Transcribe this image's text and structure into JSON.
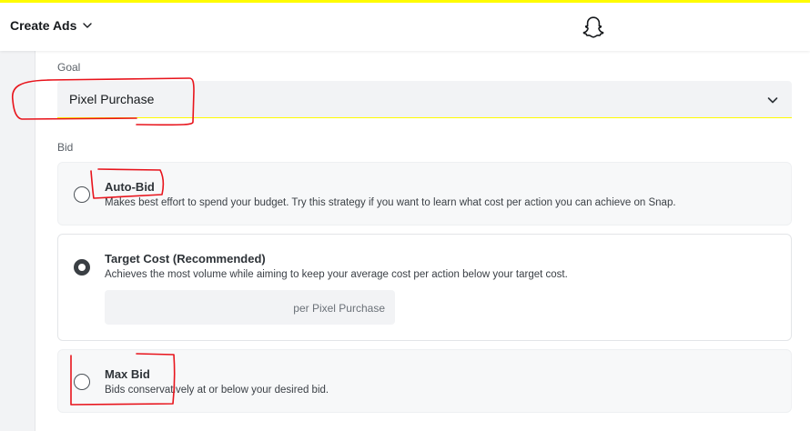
{
  "header": {
    "title": "Create Ads",
    "title_chevron_icon": "chevron-down-icon",
    "logo_icon": "snapchat-ghost-icon",
    "accent_color": "#fffc00"
  },
  "goal": {
    "label": "Goal",
    "selected_value": "Pixel Purchase",
    "chevron_icon": "chevron-down-icon"
  },
  "bid": {
    "label": "Bid",
    "options": [
      {
        "title": "Auto-Bid",
        "description": "Makes best effort to spend your budget. Try this strategy if you want to learn what cost per action you can achieve on Snap.",
        "selected": false
      },
      {
        "title": "Target Cost (Recommended)",
        "description": "Achieves the most volume while aiming to keep your average cost per action below your target cost.",
        "selected": true,
        "input_suffix": "per Pixel Purchase"
      },
      {
        "title": "Max Bid",
        "description": "Bids conservatively at or below your desired bid.",
        "selected": false
      }
    ]
  },
  "annotation_color": "#e8141c"
}
